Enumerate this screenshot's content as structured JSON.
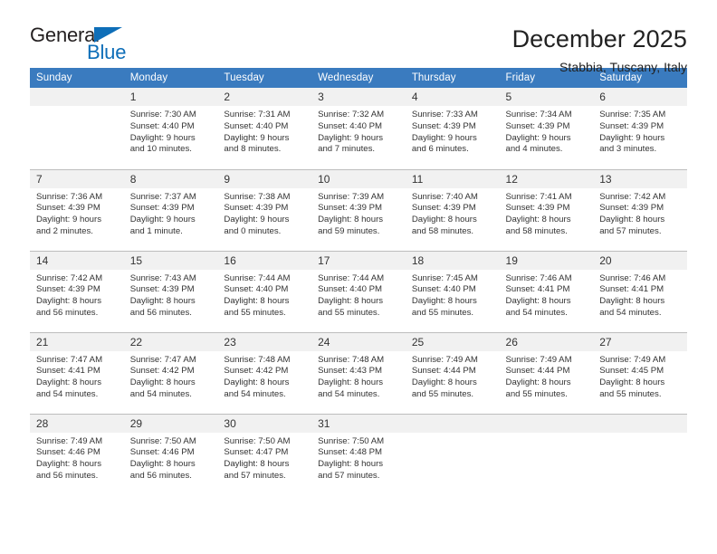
{
  "logo": {
    "word_top": "General",
    "word_bottom": "Blue",
    "triangle_icon": "triangle-icon",
    "brand_color": "#0e6eb8"
  },
  "header": {
    "title": "December 2025",
    "subtitle": "Stabbia, Tuscany, Italy"
  },
  "calendar": {
    "header_background": "#3a7bbf",
    "daynum_background": "#f1f1f1",
    "weekdays": [
      "Sunday",
      "Monday",
      "Tuesday",
      "Wednesday",
      "Thursday",
      "Friday",
      "Saturday"
    ],
    "weeks": [
      [
        {
          "day": "",
          "sunrise": "",
          "sunset": "",
          "daylight_line1": "",
          "daylight_line2": ""
        },
        {
          "day": "1",
          "sunrise": "Sunrise: 7:30 AM",
          "sunset": "Sunset: 4:40 PM",
          "daylight_line1": "Daylight: 9 hours",
          "daylight_line2": "and 10 minutes."
        },
        {
          "day": "2",
          "sunrise": "Sunrise: 7:31 AM",
          "sunset": "Sunset: 4:40 PM",
          "daylight_line1": "Daylight: 9 hours",
          "daylight_line2": "and 8 minutes."
        },
        {
          "day": "3",
          "sunrise": "Sunrise: 7:32 AM",
          "sunset": "Sunset: 4:40 PM",
          "daylight_line1": "Daylight: 9 hours",
          "daylight_line2": "and 7 minutes."
        },
        {
          "day": "4",
          "sunrise": "Sunrise: 7:33 AM",
          "sunset": "Sunset: 4:39 PM",
          "daylight_line1": "Daylight: 9 hours",
          "daylight_line2": "and 6 minutes."
        },
        {
          "day": "5",
          "sunrise": "Sunrise: 7:34 AM",
          "sunset": "Sunset: 4:39 PM",
          "daylight_line1": "Daylight: 9 hours",
          "daylight_line2": "and 4 minutes."
        },
        {
          "day": "6",
          "sunrise": "Sunrise: 7:35 AM",
          "sunset": "Sunset: 4:39 PM",
          "daylight_line1": "Daylight: 9 hours",
          "daylight_line2": "and 3 minutes."
        }
      ],
      [
        {
          "day": "7",
          "sunrise": "Sunrise: 7:36 AM",
          "sunset": "Sunset: 4:39 PM",
          "daylight_line1": "Daylight: 9 hours",
          "daylight_line2": "and 2 minutes."
        },
        {
          "day": "8",
          "sunrise": "Sunrise: 7:37 AM",
          "sunset": "Sunset: 4:39 PM",
          "daylight_line1": "Daylight: 9 hours",
          "daylight_line2": "and 1 minute."
        },
        {
          "day": "9",
          "sunrise": "Sunrise: 7:38 AM",
          "sunset": "Sunset: 4:39 PM",
          "daylight_line1": "Daylight: 9 hours",
          "daylight_line2": "and 0 minutes."
        },
        {
          "day": "10",
          "sunrise": "Sunrise: 7:39 AM",
          "sunset": "Sunset: 4:39 PM",
          "daylight_line1": "Daylight: 8 hours",
          "daylight_line2": "and 59 minutes."
        },
        {
          "day": "11",
          "sunrise": "Sunrise: 7:40 AM",
          "sunset": "Sunset: 4:39 PM",
          "daylight_line1": "Daylight: 8 hours",
          "daylight_line2": "and 58 minutes."
        },
        {
          "day": "12",
          "sunrise": "Sunrise: 7:41 AM",
          "sunset": "Sunset: 4:39 PM",
          "daylight_line1": "Daylight: 8 hours",
          "daylight_line2": "and 58 minutes."
        },
        {
          "day": "13",
          "sunrise": "Sunrise: 7:42 AM",
          "sunset": "Sunset: 4:39 PM",
          "daylight_line1": "Daylight: 8 hours",
          "daylight_line2": "and 57 minutes."
        }
      ],
      [
        {
          "day": "14",
          "sunrise": "Sunrise: 7:42 AM",
          "sunset": "Sunset: 4:39 PM",
          "daylight_line1": "Daylight: 8 hours",
          "daylight_line2": "and 56 minutes."
        },
        {
          "day": "15",
          "sunrise": "Sunrise: 7:43 AM",
          "sunset": "Sunset: 4:39 PM",
          "daylight_line1": "Daylight: 8 hours",
          "daylight_line2": "and 56 minutes."
        },
        {
          "day": "16",
          "sunrise": "Sunrise: 7:44 AM",
          "sunset": "Sunset: 4:40 PM",
          "daylight_line1": "Daylight: 8 hours",
          "daylight_line2": "and 55 minutes."
        },
        {
          "day": "17",
          "sunrise": "Sunrise: 7:44 AM",
          "sunset": "Sunset: 4:40 PM",
          "daylight_line1": "Daylight: 8 hours",
          "daylight_line2": "and 55 minutes."
        },
        {
          "day": "18",
          "sunrise": "Sunrise: 7:45 AM",
          "sunset": "Sunset: 4:40 PM",
          "daylight_line1": "Daylight: 8 hours",
          "daylight_line2": "and 55 minutes."
        },
        {
          "day": "19",
          "sunrise": "Sunrise: 7:46 AM",
          "sunset": "Sunset: 4:41 PM",
          "daylight_line1": "Daylight: 8 hours",
          "daylight_line2": "and 54 minutes."
        },
        {
          "day": "20",
          "sunrise": "Sunrise: 7:46 AM",
          "sunset": "Sunset: 4:41 PM",
          "daylight_line1": "Daylight: 8 hours",
          "daylight_line2": "and 54 minutes."
        }
      ],
      [
        {
          "day": "21",
          "sunrise": "Sunrise: 7:47 AM",
          "sunset": "Sunset: 4:41 PM",
          "daylight_line1": "Daylight: 8 hours",
          "daylight_line2": "and 54 minutes."
        },
        {
          "day": "22",
          "sunrise": "Sunrise: 7:47 AM",
          "sunset": "Sunset: 4:42 PM",
          "daylight_line1": "Daylight: 8 hours",
          "daylight_line2": "and 54 minutes."
        },
        {
          "day": "23",
          "sunrise": "Sunrise: 7:48 AM",
          "sunset": "Sunset: 4:42 PM",
          "daylight_line1": "Daylight: 8 hours",
          "daylight_line2": "and 54 minutes."
        },
        {
          "day": "24",
          "sunrise": "Sunrise: 7:48 AM",
          "sunset": "Sunset: 4:43 PM",
          "daylight_line1": "Daylight: 8 hours",
          "daylight_line2": "and 54 minutes."
        },
        {
          "day": "25",
          "sunrise": "Sunrise: 7:49 AM",
          "sunset": "Sunset: 4:44 PM",
          "daylight_line1": "Daylight: 8 hours",
          "daylight_line2": "and 55 minutes."
        },
        {
          "day": "26",
          "sunrise": "Sunrise: 7:49 AM",
          "sunset": "Sunset: 4:44 PM",
          "daylight_line1": "Daylight: 8 hours",
          "daylight_line2": "and 55 minutes."
        },
        {
          "day": "27",
          "sunrise": "Sunrise: 7:49 AM",
          "sunset": "Sunset: 4:45 PM",
          "daylight_line1": "Daylight: 8 hours",
          "daylight_line2": "and 55 minutes."
        }
      ],
      [
        {
          "day": "28",
          "sunrise": "Sunrise: 7:49 AM",
          "sunset": "Sunset: 4:46 PM",
          "daylight_line1": "Daylight: 8 hours",
          "daylight_line2": "and 56 minutes."
        },
        {
          "day": "29",
          "sunrise": "Sunrise: 7:50 AM",
          "sunset": "Sunset: 4:46 PM",
          "daylight_line1": "Daylight: 8 hours",
          "daylight_line2": "and 56 minutes."
        },
        {
          "day": "30",
          "sunrise": "Sunrise: 7:50 AM",
          "sunset": "Sunset: 4:47 PM",
          "daylight_line1": "Daylight: 8 hours",
          "daylight_line2": "and 57 minutes."
        },
        {
          "day": "31",
          "sunrise": "Sunrise: 7:50 AM",
          "sunset": "Sunset: 4:48 PM",
          "daylight_line1": "Daylight: 8 hours",
          "daylight_line2": "and 57 minutes."
        },
        {
          "day": "",
          "sunrise": "",
          "sunset": "",
          "daylight_line1": "",
          "daylight_line2": ""
        },
        {
          "day": "",
          "sunrise": "",
          "sunset": "",
          "daylight_line1": "",
          "daylight_line2": ""
        },
        {
          "day": "",
          "sunrise": "",
          "sunset": "",
          "daylight_line1": "",
          "daylight_line2": ""
        }
      ]
    ]
  }
}
